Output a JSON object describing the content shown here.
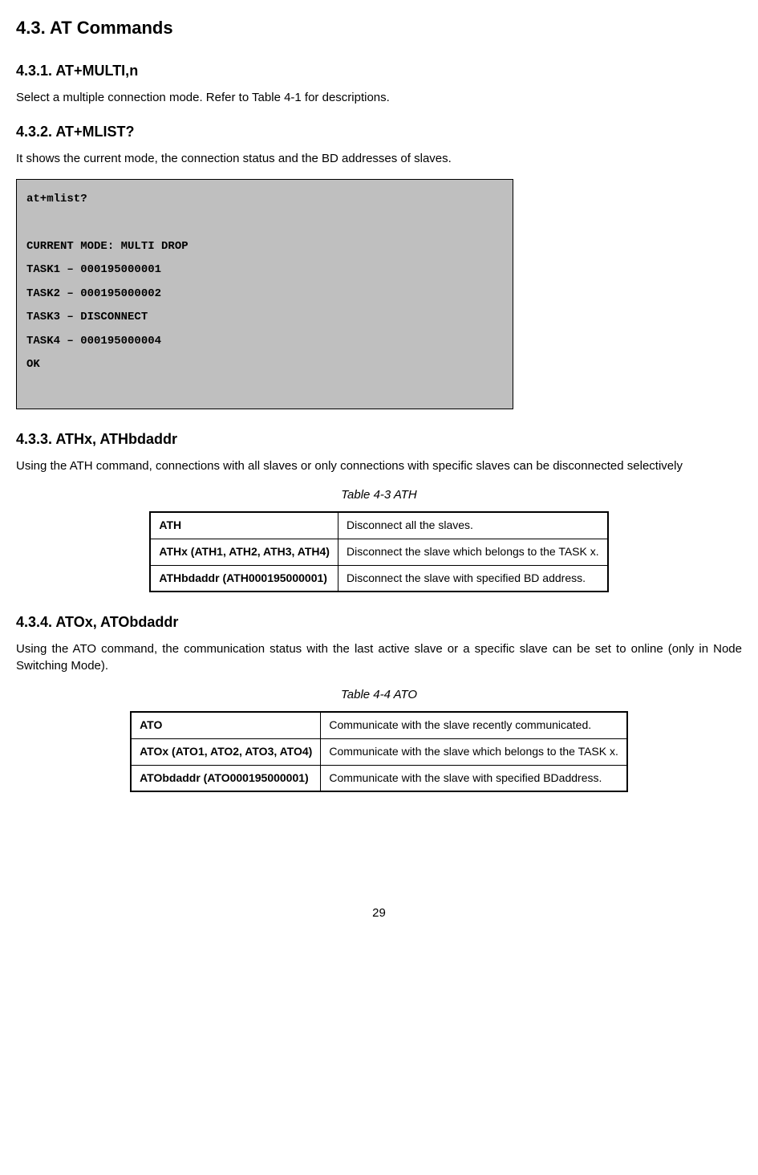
{
  "h2": "4.3. AT Commands",
  "s431": {
    "h": "4.3.1. AT+MULTI,n",
    "p": "Select a multiple connection mode. Refer to Table 4-1 for descriptions."
  },
  "s432": {
    "h": "4.3.2. AT+MLIST?",
    "p": "It shows the current mode, the connection status and the BD addresses of slaves.",
    "code": "at+mlist?\n\nCURRENT MODE: MULTI DROP\nTASK1 – 000195000001\nTASK2 – 000195000002\nTASK3 – DISCONNECT\nTASK4 – 000195000004\nOK"
  },
  "s433": {
    "h": "4.3.3. ATHx, ATHbdaddr",
    "p": "Using the ATH command, connections with all slaves or only connections with specific slaves can be disconnected selectively",
    "caption": "Table 4-3 ATH",
    "rows": [
      {
        "c": "ATH",
        "d": "Disconnect all the slaves."
      },
      {
        "c": "ATHx (ATH1, ATH2, ATH3, ATH4)",
        "d": "Disconnect the slave which belongs to the TASK x."
      },
      {
        "c": "ATHbdaddr (ATH000195000001)",
        "d": "Disconnect the slave with specified BD address."
      }
    ]
  },
  "s434": {
    "h": "4.3.4. ATOx, ATObdaddr",
    "p": "Using the ATO command, the communication status with the last active slave or a specific slave can be set to online (only in Node Switching Mode).",
    "caption": "Table 4-4 ATO",
    "rows": [
      {
        "c": "ATO",
        "d": "Communicate with the slave recently communicated."
      },
      {
        "c": "ATOx (ATO1, ATO2, ATO3, ATO4)",
        "d": "Communicate with the slave which belongs to the TASK x."
      },
      {
        "c": "ATObdaddr (ATO000195000001)",
        "d": "Communicate with the slave with specified BDaddress."
      }
    ]
  },
  "pageNumber": "29"
}
